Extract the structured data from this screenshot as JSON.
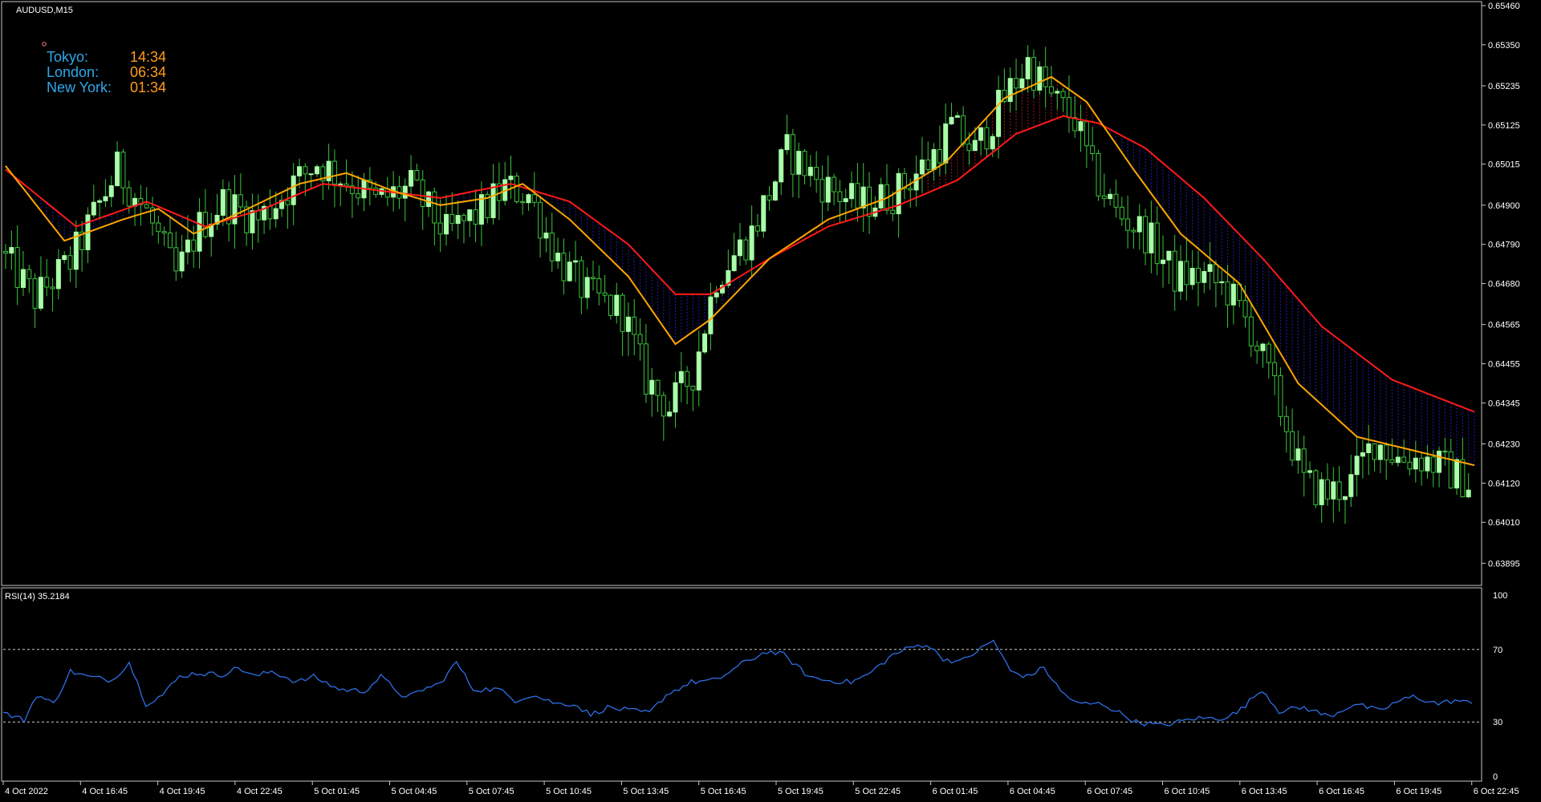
{
  "window": {
    "symbol_label": "AUDUSD,M15",
    "rsi_label": "RSI(14) 35.2184"
  },
  "clocks": [
    {
      "name": "Tokyo:",
      "time": "14:34"
    },
    {
      "name": "London:",
      "time": "06:34"
    },
    {
      "name": "New York:",
      "time": "01:34"
    }
  ],
  "colors": {
    "background": "#000000",
    "candle_bull": "#a8ffa8",
    "candle_wick": "#3ac63a",
    "ma_fast": "#ffa500",
    "ma_slow": "#ff1a1a",
    "cloud_bear": "#1c1cb4",
    "cloud_bull": "#a01c1c",
    "rsi_line": "#2e6fe6",
    "level_line": "#cccccc",
    "clock_name": "#2ea8e8",
    "clock_time": "#ff9e1a"
  },
  "chart_data": [
    {
      "type": "candlestick",
      "title": "AUDUSD,M15",
      "price_axis_ticks": [
        "0.65460",
        "0.65350",
        "0.65235",
        "0.65125",
        "0.65015",
        "0.64900",
        "0.64790",
        "0.64680",
        "0.64565",
        "0.64455",
        "0.64345",
        "0.64230",
        "0.64120",
        "0.64010",
        "0.63895"
      ],
      "ylim": [
        0.6388,
        0.6546
      ],
      "time_axis_ticks": [
        "4 Oct 2022",
        "4 Oct 16:45",
        "4 Oct 19:45",
        "4 Oct 22:45",
        "5 Oct 01:45",
        "5 Oct 04:45",
        "5 Oct 07:45",
        "5 Oct 10:45",
        "5 Oct 13:45",
        "5 Oct 16:45",
        "5 Oct 19:45",
        "5 Oct 22:45",
        "6 Oct 01:45",
        "6 Oct 04:45",
        "6 Oct 07:45",
        "6 Oct 10:45",
        "6 Oct 13:45",
        "6 Oct 16:45",
        "6 Oct 19:45",
        "6 Oct 22:45"
      ],
      "close_path": [
        [
          0,
          0.6477
        ],
        [
          6,
          0.6464
        ],
        [
          12,
          0.6474
        ],
        [
          20,
          0.65
        ],
        [
          25,
          0.6488
        ],
        [
          30,
          0.647
        ],
        [
          34,
          0.6484
        ],
        [
          38,
          0.6491
        ],
        [
          44,
          0.6486
        ],
        [
          50,
          0.6496
        ],
        [
          54,
          0.6502
        ],
        [
          60,
          0.6496
        ],
        [
          64,
          0.6491
        ],
        [
          70,
          0.6495
        ],
        [
          76,
          0.6482
        ],
        [
          82,
          0.6488
        ],
        [
          86,
          0.6495
        ],
        [
          90,
          0.6493
        ],
        [
          95,
          0.6475
        ],
        [
          100,
          0.6465
        ],
        [
          106,
          0.646
        ],
        [
          110,
          0.6441
        ],
        [
          114,
          0.6433
        ],
        [
          118,
          0.6443
        ],
        [
          122,
          0.647
        ],
        [
          128,
          0.6482
        ],
        [
          134,
          0.6505
        ],
        [
          140,
          0.6496
        ],
        [
          146,
          0.649
        ],
        [
          152,
          0.6493
        ],
        [
          158,
          0.6502
        ],
        [
          162,
          0.6512
        ],
        [
          166,
          0.6505
        ],
        [
          171,
          0.652
        ],
        [
          175,
          0.653
        ],
        [
          179,
          0.652
        ],
        [
          183,
          0.6514
        ],
        [
          186,
          0.6499
        ],
        [
          190,
          0.6488
        ],
        [
          195,
          0.6482
        ],
        [
          200,
          0.647
        ],
        [
          205,
          0.647
        ],
        [
          209,
          0.6466
        ],
        [
          213,
          0.6455
        ],
        [
          216,
          0.6442
        ],
        [
          219,
          0.6428
        ],
        [
          222,
          0.6412
        ],
        [
          226,
          0.6409
        ],
        [
          230,
          0.6412
        ],
        [
          234,
          0.6424
        ],
        [
          238,
          0.6419
        ],
        [
          242,
          0.6419
        ],
        [
          246,
          0.6416
        ],
        [
          250,
          0.6412
        ]
      ],
      "ma_fast_path": [
        [
          0,
          0.6501
        ],
        [
          10,
          0.648
        ],
        [
          20,
          0.6486
        ],
        [
          26,
          0.6489
        ],
        [
          32,
          0.6482
        ],
        [
          40,
          0.6488
        ],
        [
          50,
          0.6496
        ],
        [
          58,
          0.6499
        ],
        [
          66,
          0.6494
        ],
        [
          74,
          0.649
        ],
        [
          82,
          0.6492
        ],
        [
          88,
          0.6496
        ],
        [
          96,
          0.6486
        ],
        [
          106,
          0.647
        ],
        [
          114,
          0.6451
        ],
        [
          120,
          0.6458
        ],
        [
          130,
          0.6475
        ],
        [
          140,
          0.6486
        ],
        [
          150,
          0.6492
        ],
        [
          160,
          0.6502
        ],
        [
          170,
          0.652
        ],
        [
          178,
          0.6526
        ],
        [
          184,
          0.6519
        ],
        [
          192,
          0.65
        ],
        [
          200,
          0.6482
        ],
        [
          210,
          0.6468
        ],
        [
          220,
          0.644
        ],
        [
          230,
          0.6425
        ],
        [
          240,
          0.6421
        ],
        [
          250,
          0.6417
        ]
      ],
      "ma_slow_path": [
        [
          0,
          0.65
        ],
        [
          12,
          0.6484
        ],
        [
          24,
          0.6491
        ],
        [
          34,
          0.6484
        ],
        [
          44,
          0.6489
        ],
        [
          54,
          0.6496
        ],
        [
          64,
          0.6494
        ],
        [
          74,
          0.6492
        ],
        [
          86,
          0.6496
        ],
        [
          96,
          0.6491
        ],
        [
          106,
          0.6479
        ],
        [
          114,
          0.6465
        ],
        [
          120,
          0.6465
        ],
        [
          130,
          0.6475
        ],
        [
          140,
          0.6484
        ],
        [
          152,
          0.649
        ],
        [
          162,
          0.6497
        ],
        [
          172,
          0.651
        ],
        [
          180,
          0.6515
        ],
        [
          186,
          0.6513
        ],
        [
          194,
          0.6506
        ],
        [
          204,
          0.6492
        ],
        [
          214,
          0.6475
        ],
        [
          224,
          0.6456
        ],
        [
          236,
          0.6441
        ],
        [
          250,
          0.6432
        ]
      ]
    },
    {
      "type": "line",
      "title": "RSI(14) 35.2184",
      "ylim": [
        0,
        100
      ],
      "levels": [
        30,
        70
      ],
      "axis_ticks": [
        "100",
        "70",
        "30",
        "0"
      ],
      "path": [
        [
          0,
          35
        ],
        [
          5,
          31
        ],
        [
          8,
          45
        ],
        [
          12,
          40
        ],
        [
          16,
          58
        ],
        [
          20,
          55
        ],
        [
          26,
          53
        ],
        [
          30,
          63
        ],
        [
          34,
          40
        ],
        [
          38,
          45
        ],
        [
          42,
          55
        ],
        [
          46,
          57
        ],
        [
          52,
          56
        ],
        [
          56,
          60
        ],
        [
          60,
          55
        ],
        [
          64,
          58
        ],
        [
          70,
          52
        ],
        [
          74,
          55
        ],
        [
          80,
          48
        ],
        [
          86,
          47
        ],
        [
          90,
          55
        ],
        [
          96,
          43
        ],
        [
          100,
          48
        ],
        [
          104,
          51
        ],
        [
          108,
          63
        ],
        [
          112,
          48
        ],
        [
          118,
          48
        ],
        [
          122,
          42
        ],
        [
          126,
          45
        ],
        [
          132,
          40
        ],
        [
          136,
          40
        ],
        [
          140,
          34
        ],
        [
          144,
          38
        ],
        [
          150,
          36
        ],
        [
          154,
          35
        ],
        [
          158,
          45
        ],
        [
          164,
          52
        ],
        [
          170,
          53
        ],
        [
          176,
          62
        ],
        [
          182,
          69
        ],
        [
          186,
          67
        ],
        [
          192,
          55
        ],
        [
          196,
          53
        ],
        [
          202,
          52
        ],
        [
          206,
          56
        ],
        [
          212,
          67
        ],
        [
          216,
          71
        ],
        [
          220,
          73
        ],
        [
          224,
          65
        ],
        [
          228,
          63
        ],
        [
          232,
          69
        ],
        [
          236,
          75
        ],
        [
          240,
          58
        ],
        [
          244,
          55
        ],
        [
          248,
          60
        ],
        [
          252,
          47
        ],
        [
          256,
          40
        ],
        [
          262,
          40
        ],
        [
          266,
          35
        ],
        [
          270,
          30
        ],
        [
          276,
          28
        ],
        [
          280,
          30
        ],
        [
          284,
          32
        ],
        [
          290,
          32
        ],
        [
          294,
          35
        ],
        [
          300,
          48
        ],
        [
          304,
          36
        ],
        [
          310,
          38
        ],
        [
          316,
          33
        ],
        [
          322,
          40
        ],
        [
          328,
          36
        ],
        [
          332,
          41
        ],
        [
          336,
          44
        ],
        [
          342,
          40
        ],
        [
          346,
          42
        ],
        [
          350,
          40
        ]
      ]
    }
  ]
}
